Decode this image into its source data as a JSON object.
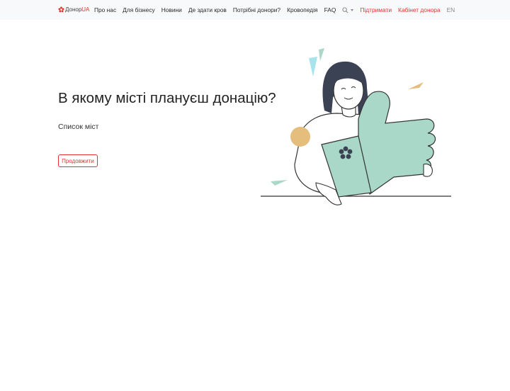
{
  "nav": {
    "logo": {
      "prefix": "Донор",
      "suffix": "UA"
    },
    "links": [
      "Про нас",
      "Для бізнесу",
      "Новини",
      "Де здати кров",
      "Потрібні донори?",
      "Кровопедія",
      "FAQ"
    ],
    "support": "Підтримати",
    "cabinet": "Кабінет донора",
    "lang": "EN",
    "search_icon": "search-icon"
  },
  "hero": {
    "title": "В якому місті плануєш донацію?",
    "city_select_label": "Список міст",
    "continue_label": "Продовжити"
  },
  "colors": {
    "brand_red": "#e0342f",
    "thumb_green": "#a9d8c8",
    "accent_yellow": "#e5bd7c",
    "accent_blue": "#a6e3ec"
  }
}
